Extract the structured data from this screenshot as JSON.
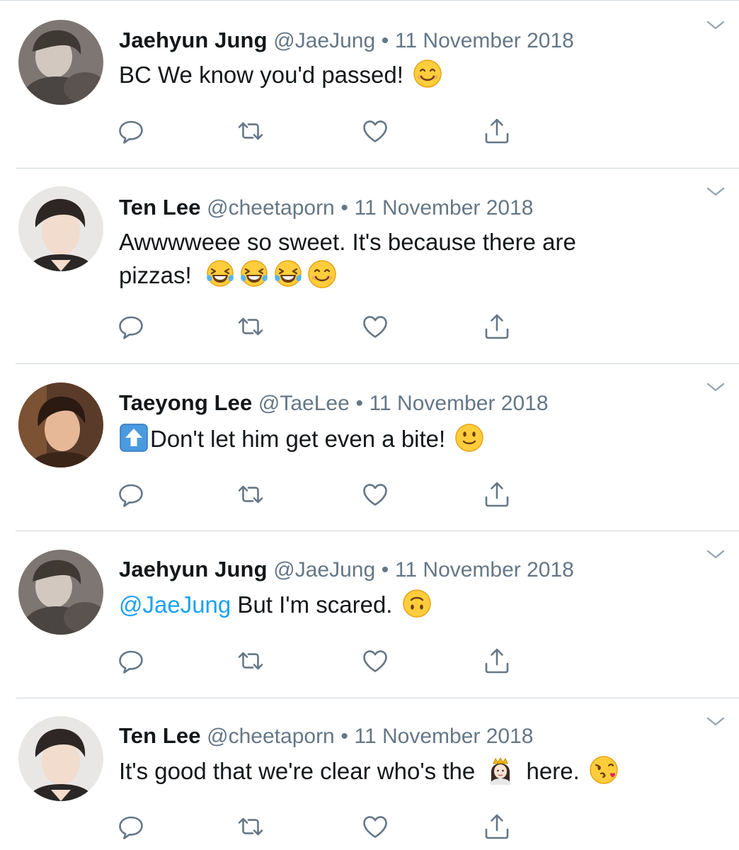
{
  "colors": {
    "text": "#14171a",
    "meta": "#657786",
    "mention": "#1da1f2",
    "divider": "#cfd6dc"
  },
  "tweets": [
    {
      "name": "Jaehyun Jung",
      "handle": "@JaeJung",
      "separator": "•",
      "date": "11 November 2018",
      "text_lines": [
        "BC We know you'd passed!"
      ],
      "emojis": [
        "smiling-face-emoji"
      ]
    },
    {
      "name": "Ten Lee",
      "handle": "@cheetaporn",
      "separator": "•",
      "date": "11 November 2018",
      "text_lines": [
        "Awwwweee so sweet. It's because there are",
        "pizzas!"
      ],
      "emojis": [
        "tears-of-joy-emoji",
        "tears-of-joy-emoji",
        "tears-of-joy-emoji",
        "smiling-face-emoji"
      ]
    },
    {
      "name": "Taeyong Lee",
      "handle": "@TaeLee",
      "separator": "•",
      "date": "11 November 2018",
      "text_lines": [
        "Don't let him get even a bite!"
      ],
      "emojis": [
        "up-arrow-emoji",
        "slight-smile-emoji"
      ]
    },
    {
      "name": "Jaehyun Jung",
      "handle": "@JaeJung",
      "separator": "•",
      "date": "11 November 2018",
      "mention": "@JaeJung",
      "text_lines": [
        " But I'm scared."
      ],
      "emojis": [
        "upside-down-face-emoji"
      ]
    },
    {
      "name": "Ten Lee",
      "handle": "@cheetaporn",
      "separator": "•",
      "date": "11 November 2018",
      "text_lines": [
        "It's good that we're clear who's the",
        "here."
      ],
      "emojis": [
        "princess-emoji",
        "blowing-kiss-emoji"
      ]
    }
  ],
  "action_icons": [
    "reply-icon",
    "retweet-icon",
    "like-icon",
    "share-icon"
  ]
}
